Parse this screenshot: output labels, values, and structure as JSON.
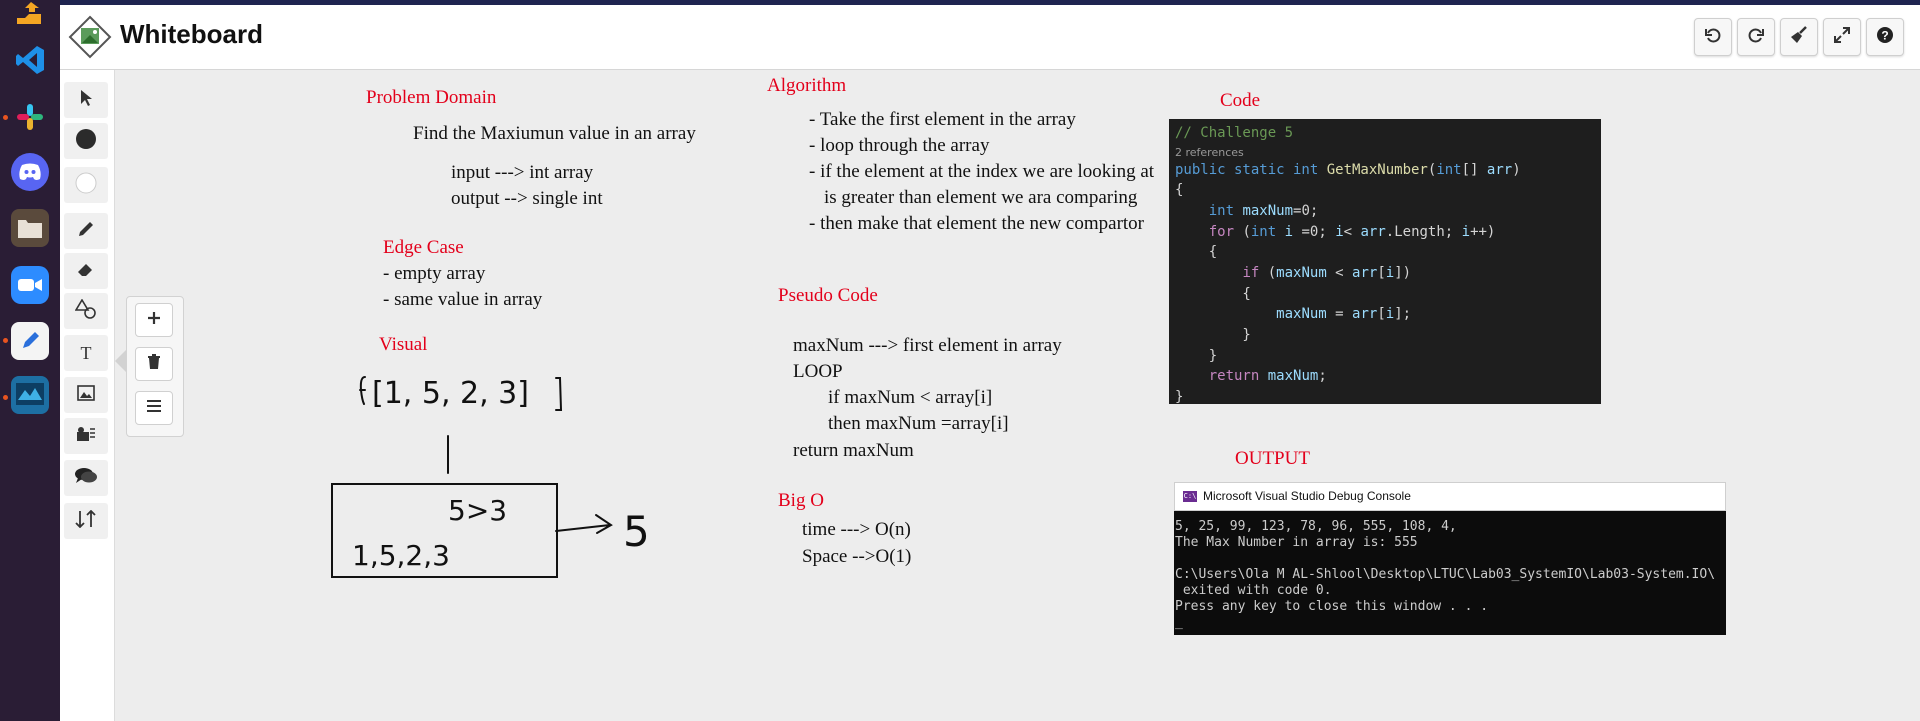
{
  "app": {
    "title": "Whiteboard"
  },
  "toolbar": {
    "undo_icon": "undo-icon",
    "redo_icon": "redo-icon",
    "clear_icon": "broom-icon",
    "fullscreen_icon": "expand-icon",
    "help_icon": "help-icon"
  },
  "tools": [
    "select",
    "ink-black",
    "ink-white",
    "pencil",
    "eraser",
    "shapes",
    "text",
    "image",
    "image-text",
    "chat",
    "sort"
  ],
  "tools_text_glyph": "T",
  "popover": [
    "add",
    "delete",
    "menu"
  ],
  "board": {
    "problem": {
      "heading": "Problem Domain",
      "statement": "Find the Maxiumun value in an array",
      "input": "input ---> int array",
      "output": "output --> single int"
    },
    "edge": {
      "heading": "Edge Case",
      "items": [
        "- empty array",
        "- same value in array"
      ]
    },
    "visual": {
      "heading": "Visual",
      "sketch_array": "[1, 5, 2, 3]",
      "sketch_box_top": "5>3",
      "sketch_box_bottom": "1,5,2,3",
      "sketch_result": "5"
    },
    "algorithm": {
      "heading": "Algorithm",
      "steps": [
        "- Take the first element in the array",
        "- loop through the array",
        "- if the element at the index we are looking at",
        "is greater than element we ara comparing",
        "- then make that element the new compartor"
      ]
    },
    "pseudo": {
      "heading": "Pseudo Code",
      "lines": [
        "maxNum ---> first element in array",
        "LOOP",
        "if maxNum < array[i]",
        "then maxNum =array[i]",
        "return maxNum"
      ]
    },
    "bigo": {
      "heading": "Big O",
      "time": "time ---> O(n)",
      "space": "Space -->O(1)"
    },
    "code": {
      "heading": "Code",
      "comment": "// Challenge 5",
      "refs": "2 references",
      "lines": [
        "{",
        "    int maxNum=0;",
        "    for (int i =0; i< arr.Length; i++)",
        "    {",
        "        if (maxNum < arr[i])",
        "        {",
        "            maxNum = arr[i];",
        "        }",
        "    }",
        "    return maxNum;",
        "}"
      ],
      "signature": "public static int GetMaxNumber(int[] arr)"
    },
    "output": {
      "heading": "OUTPUT",
      "console_title": "Microsoft Visual Studio Debug Console",
      "console_badge": "C:\\",
      "console_lines": [
        "5, 25, 99, 123, 78, 96, 555, 108, 4,",
        "The Max Number in array is: 555",
        "",
        "C:\\Users\\Ola M AL-Shlool\\Desktop\\LTUC\\Lab03_SystemIO\\Lab03-System.IO\\",
        " exited with code 0.",
        "Press any key to close this window . . .",
        "_"
      ]
    }
  },
  "colors": {
    "heading_red": "#e3001b",
    "dock_bg": "#2a1d35",
    "code_bg": "#1e1e1e"
  }
}
